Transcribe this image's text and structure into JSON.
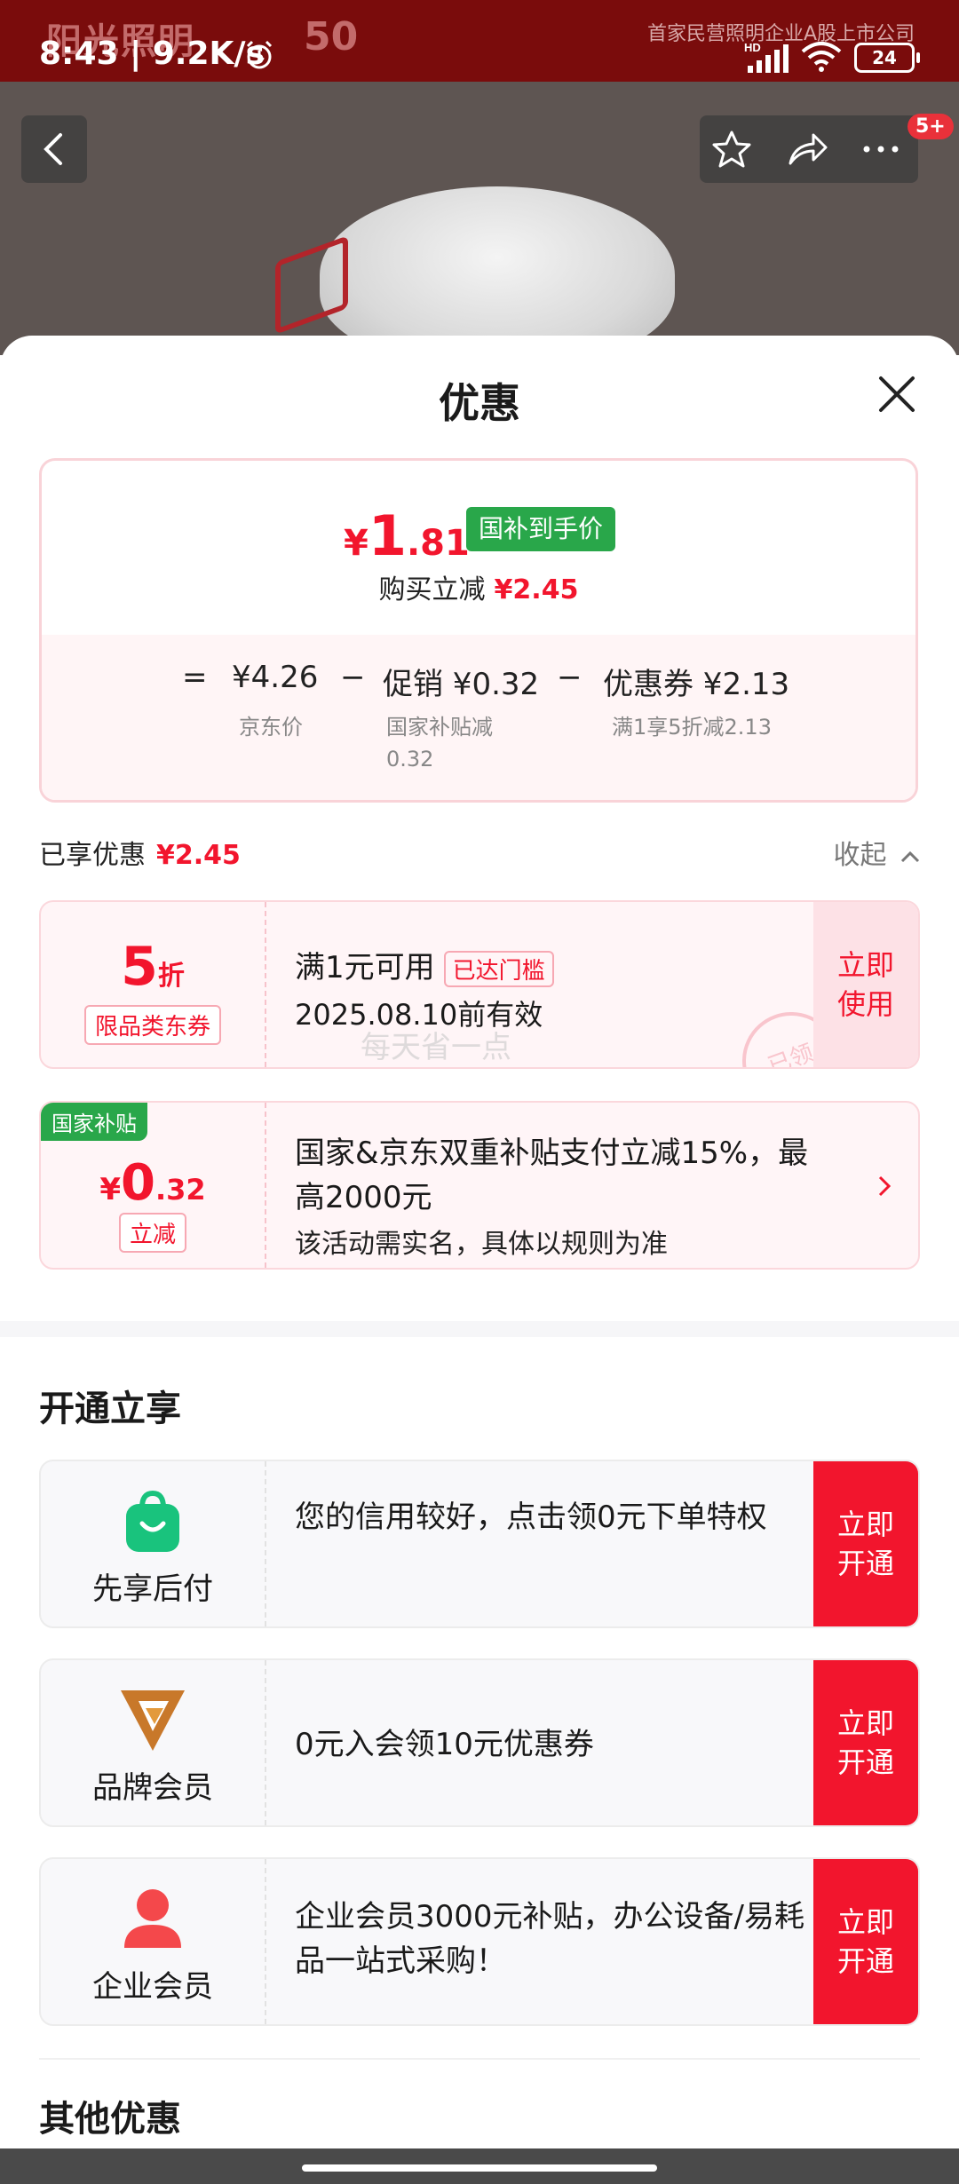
{
  "status_bar": {
    "time": "8:43 | 9.2K/s",
    "battery": "24"
  },
  "banner": {
    "brand": "阳光照明",
    "anniversary": "50",
    "slogan": "首家民营照明企业A股上市公司"
  },
  "top_nav": {
    "more_badge": "5+"
  },
  "sheet": {
    "title": "优惠"
  },
  "price_summary": {
    "final_yen": "¥",
    "final_int": "1",
    "final_dec": ".81",
    "final_tag": "国补到手价",
    "reduce_label": "购买立减",
    "reduce_amount": "¥2.45",
    "equals": "=",
    "jd_price": "¥4.26",
    "jd_price_label": "京东价",
    "minus1": "−",
    "promo": "促销 ¥0.32",
    "promo_label_line1": "国家补贴减",
    "promo_label_line2": "0.32",
    "minus2": "−",
    "coupon": "优惠券 ¥2.13",
    "coupon_label": "满1享5折减2.13"
  },
  "enjoyed": {
    "label": "已享优惠",
    "amount": "¥2.45",
    "collapse_label": "收起"
  },
  "coupon_card": {
    "discount_num": "5",
    "discount_unit": "折",
    "tag": "限品类东券",
    "title": "满1元可用",
    "reached": "已达门槛",
    "validity": "2025.08.10前有效",
    "use_btn": "立即使用",
    "stamp": "已领",
    "watermark": "每天省一点"
  },
  "subsidy_card": {
    "flag": "国家补贴",
    "yen": "¥",
    "int": "0",
    "dec": ".32",
    "tag": "立减",
    "line1": "国家&京东双重补贴支付立减15%，最高2000元",
    "line2": "该活动需实名，具体以规则为准"
  },
  "open_section": {
    "title": "开通立享",
    "cards": [
      {
        "label": "先享后付",
        "desc": "您的信用较好，点击领0元下单特权",
        "btn": "立即开通",
        "icon": "shopping-bag-icon"
      },
      {
        "label": "品牌会员",
        "desc": "0元入会领10元优惠券",
        "btn": "立即开通",
        "icon": "v-logo-icon"
      },
      {
        "label": "企业会员",
        "desc": " 企业会员3000元补贴，办公设备/易耗品一站式采购！",
        "btn": "立即开通",
        "icon": "person-icon"
      }
    ]
  },
  "other_section": {
    "title": "其他优惠"
  },
  "colors": {
    "accent_red": "#f2152d",
    "green_tag": "#29a74a"
  }
}
